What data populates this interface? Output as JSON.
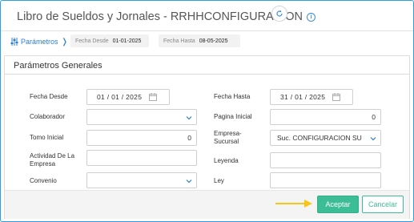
{
  "header": {
    "title": "Libro de Sueldos y Jornales - RRHHCONFIGURACION"
  },
  "filters": {
    "params_label": "Parámetros",
    "chips": [
      {
        "label": "Fecha Desde",
        "value": "01-01-2025"
      },
      {
        "label": "Fecha Hasta",
        "value": "08-05-2025"
      }
    ]
  },
  "panel": {
    "title": "Parámetros Generales",
    "fields": {
      "fecha_desde": {
        "label": "Fecha Desde",
        "day": "01",
        "month": "01",
        "year": "2025"
      },
      "fecha_hasta": {
        "label": "Fecha Hasta",
        "day": "31",
        "month": "01",
        "year": "2025"
      },
      "colaborador": {
        "label": "Colaborador",
        "value": ""
      },
      "pagina_inicial": {
        "label": "Pagina Inicial",
        "value": "0"
      },
      "tomo_inicial": {
        "label": "Tomo Inicial",
        "value": "0"
      },
      "empresa_sucursal": {
        "label_line1": "Empresa-",
        "label_line2": "Sucursal",
        "value": "Suc. CONFIGURACION SU"
      },
      "actividad": {
        "label_line1": "Actividad De La",
        "label_line2": "Empresa",
        "value": ""
      },
      "leyenda": {
        "label": "Leyenda",
        "value": ""
      },
      "convenio": {
        "label": "Convenio",
        "value": ""
      },
      "ley": {
        "label": "Ley",
        "value": ""
      }
    }
  },
  "footer": {
    "accept_label": "Aceptar",
    "cancel_label": "Cancelar"
  },
  "colors": {
    "accent_blue": "#2a7fd0",
    "accept_green": "#3dbd96",
    "arrow_yellow": "#f5c518"
  }
}
